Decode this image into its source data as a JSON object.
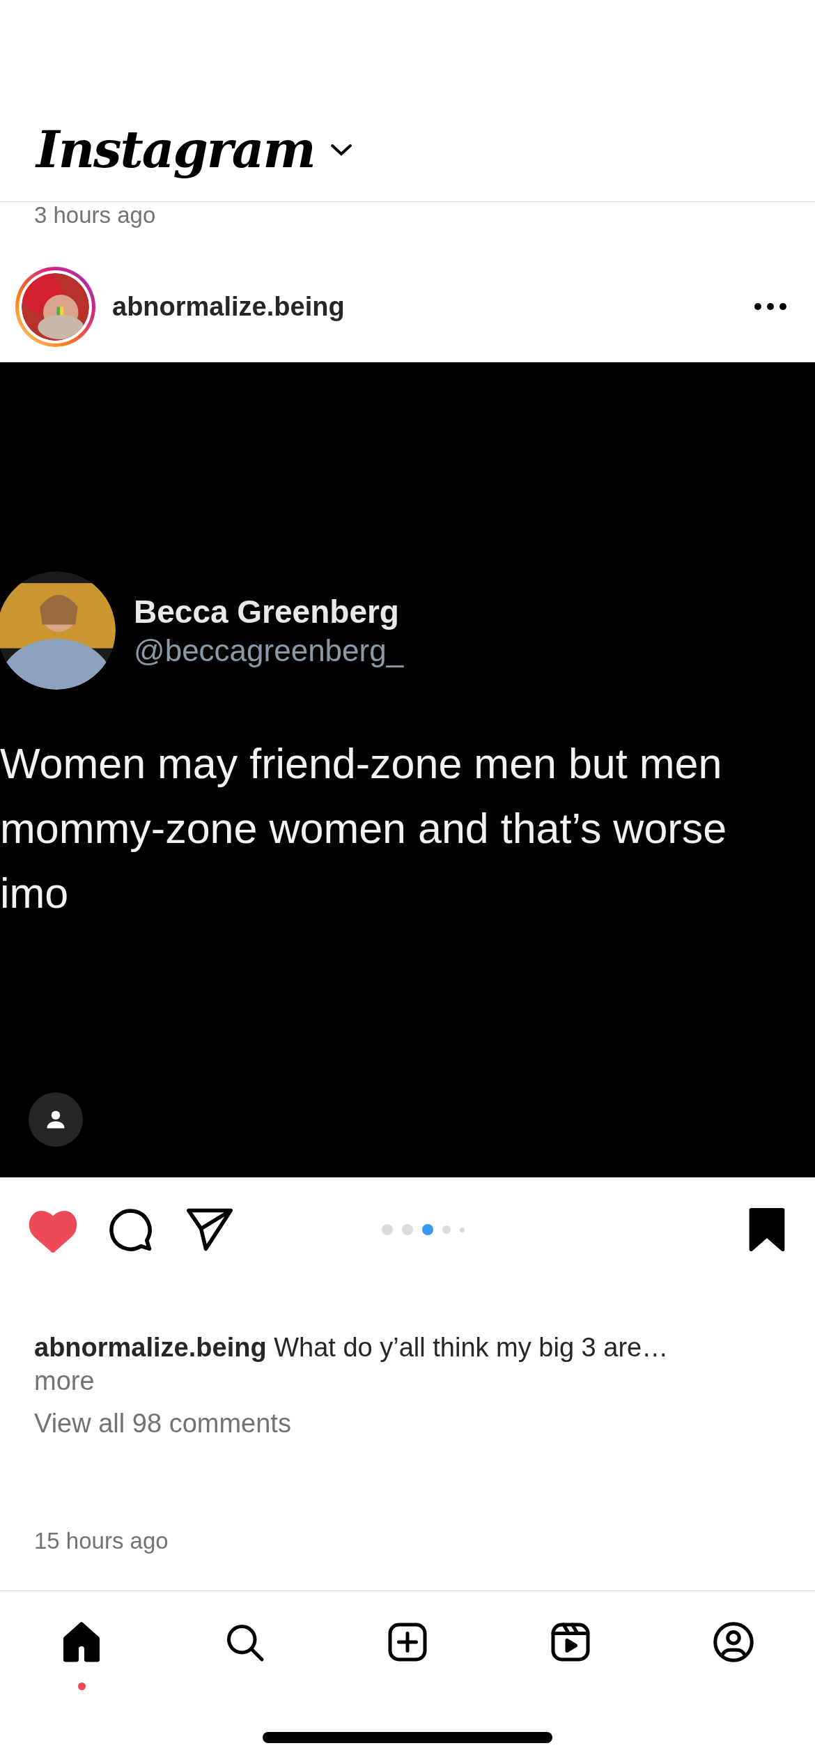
{
  "header": {
    "logo": "Instagram"
  },
  "previous_post": {
    "time": "3 hours ago"
  },
  "post": {
    "username": "abnormalize.being",
    "tweet": {
      "name": "Becca Greenberg",
      "handle": "@beccagreenberg_",
      "lines": [
        "Women may friend-zone men but men",
        "mommy-zone women and that’s worse",
        "imo"
      ]
    },
    "liked": true,
    "saved": true,
    "carousel_dots": [
      {
        "selected": false,
        "kind": "large"
      },
      {
        "selected": false,
        "kind": "large"
      },
      {
        "selected": true,
        "kind": "large"
      },
      {
        "selected": false,
        "kind": "medium"
      },
      {
        "selected": false,
        "kind": "small"
      }
    ],
    "caption_user": "abnormalize.being",
    "caption": "What do y’all think my big 3 are…",
    "more": "more",
    "comments_link": "View all 98 comments",
    "time": "15 hours ago"
  },
  "nav": [
    {
      "kind": "home",
      "selected": true,
      "activity_dot": true
    },
    {
      "kind": "search",
      "selected": false,
      "activity_dot": false
    },
    {
      "kind": "create",
      "selected": false,
      "activity_dot": false
    },
    {
      "kind": "reels",
      "selected": false,
      "activity_dot": false
    },
    {
      "kind": "profile",
      "selected": false,
      "activity_dot": false
    }
  ]
}
